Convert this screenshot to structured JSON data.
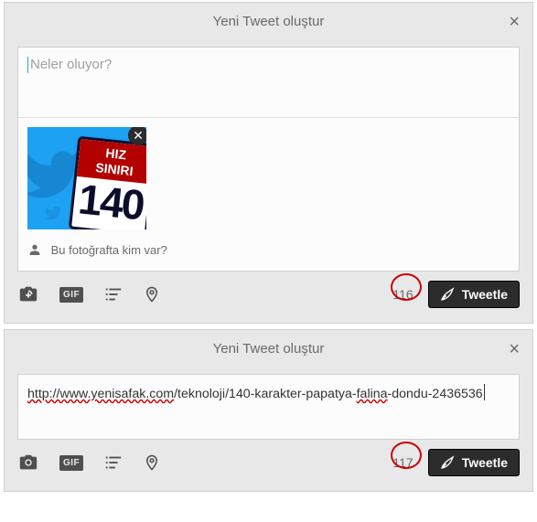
{
  "panel1": {
    "header_title": "Yeni Tweet oluştur",
    "compose_placeholder": "Neler oluyor?",
    "sign_text_line1": "HIZ",
    "sign_text_line2": "SINIRI",
    "sign_number": "140",
    "tag_prompt": "Bu fotoğrafta kim var?",
    "gif_label": "GIF",
    "char_count": "116",
    "tweet_button": "Tweetle"
  },
  "panel2": {
    "header_title": "Yeni Tweet oluştur",
    "compose_text_a": "http://www.yenisafak.com",
    "compose_text_b": "/teknoloji/140-karakter-papatya-",
    "compose_text_c": "falina",
    "compose_text_d": "-dondu-2436536",
    "gif_label": "GIF",
    "char_count": "117",
    "tweet_button": "Tweetle"
  }
}
